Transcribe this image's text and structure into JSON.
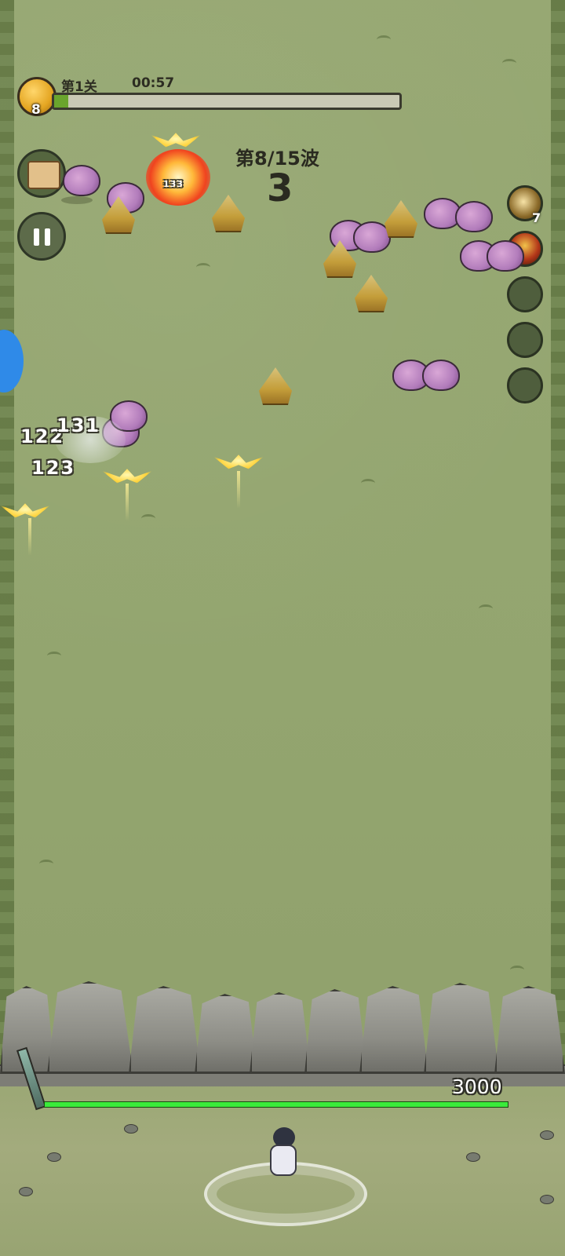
{
  "hud": {
    "stage_label": "第1关",
    "timer": "00:57",
    "player_level": "8",
    "stage_progress": 0.04
  },
  "wave": {
    "label": "第8/15波",
    "remaining": "3"
  },
  "skills": {
    "skill_1_count": "7"
  },
  "damage_numbers": {
    "explosion": "133",
    "left_1": "122",
    "left_2": "131",
    "left_3": "123"
  },
  "wall": {
    "hp": "3000",
    "hp_fraction": 1.0,
    "hp_color": "#3aeb3a"
  },
  "colors": {
    "grass": "#92a46d",
    "progress_fill": "#6aa52d",
    "bird_purple": "#b27cbb",
    "spike_gold": "#c49e3a"
  },
  "icons": {
    "level_badge": "gold-emblem-icon",
    "map": "map-scroll-icon",
    "pause": "pause-icon",
    "skill_1": "blade-skill-icon",
    "skill_2": "fire-skill-icon"
  }
}
